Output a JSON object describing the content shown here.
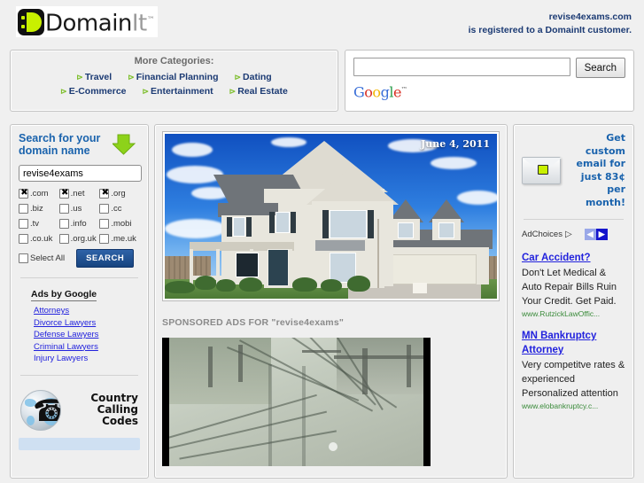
{
  "header": {
    "logo_text_domain": "Domain",
    "logo_text_it": "It",
    "logo_tm": "™",
    "domain_name": "revise4exams.com",
    "registered_line": "is registered to a DomainIt customer."
  },
  "categories": {
    "title": "More Categories:",
    "bullet": "⊳",
    "row1": [
      "Travel",
      "Financial Planning",
      "Dating"
    ],
    "row2": [
      "E-Commerce",
      "Entertainment",
      "Real Estate"
    ]
  },
  "google_search": {
    "input_value": "",
    "placeholder": "",
    "button_label": "Search",
    "logo_g1": "G",
    "logo_o1": "o",
    "logo_o2": "o",
    "logo_g2": "g",
    "logo_l": "l",
    "logo_e": "e",
    "logo_tm": "™"
  },
  "domain_search": {
    "heading": "Search for your domain name",
    "arrow_icon": "down-arrow-icon",
    "input_value": "revise4exams",
    "placeholder": "",
    "tlds": [
      {
        "label": ".com",
        "checked": true
      },
      {
        "label": ".net",
        "checked": true
      },
      {
        "label": ".org",
        "checked": true
      },
      {
        "label": ".biz",
        "checked": false
      },
      {
        "label": ".us",
        "checked": false
      },
      {
        "label": ".cc",
        "checked": false
      },
      {
        "label": ".tv",
        "checked": false
      },
      {
        "label": ".info",
        "checked": false
      },
      {
        "label": ".mobi",
        "checked": false
      },
      {
        "label": ".co.uk",
        "checked": false
      },
      {
        "label": ".org.uk",
        "checked": false
      },
      {
        "label": ".me.uk",
        "checked": false
      }
    ],
    "select_all_label": "Select All",
    "select_all_checked": false,
    "search_button": "SEARCH"
  },
  "left_ads": {
    "heading": "Ads by Google",
    "links": [
      "Attorneys",
      "Divorce Lawyers",
      "Defense Lawyers",
      "Criminal Lawyers",
      "Injury Lawyers"
    ]
  },
  "country_calling": {
    "line1": "Country",
    "line2": "Calling",
    "line3": "Codes",
    "globe_icon": "globe-phone-icon",
    "handset_glyph": "☎"
  },
  "center": {
    "photo_date": "June 4, 2011",
    "photo_alt": "suburban-house-photo",
    "sponsored_heading": "SPONSORED ADS FOR \"revise4exams\"",
    "video_alt": "grayscale-railway-tracks-video"
  },
  "right": {
    "email_ad": "Get custom email for just 83¢ per month!",
    "envelope_icon": "envelope-icon",
    "adchoices_label": "AdChoices",
    "adchoices_icon": "adchoices-triangle-icon",
    "prev_arrow": "◀",
    "next_arrow": "▶",
    "ads": [
      {
        "title": "Car Accident?",
        "body": "Don't Let Medical & Auto Repair Bills Ruin Your Credit. Get Paid.",
        "url": "www.RutzickLawOffic..."
      },
      {
        "title": "MN Bankruptcy Attorney",
        "body": "Very competitve rates & experienced Personalized attention",
        "url": "www.elobankruptcy.c..."
      }
    ]
  },
  "colors": {
    "page_bg": "#f0f0f0",
    "panel_bg": "#efefef",
    "panel_border": "#c4c4c4",
    "brand_blue": "#1b3a73",
    "link_blue": "#2222dd",
    "heading_blue": "#1a63ad",
    "accent_green": "#c8f000",
    "bullet_green": "#7fbf2f",
    "search_button": "#17447f",
    "ad_url_green": "#3a8b3a"
  }
}
